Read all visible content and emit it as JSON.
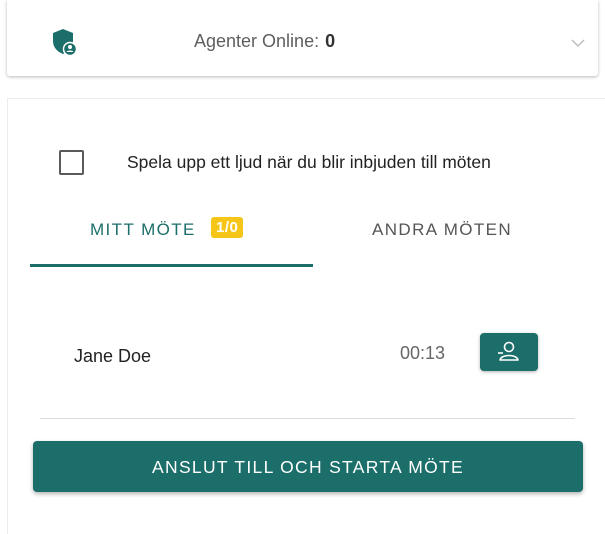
{
  "header": {
    "agents_label": "Agenter Online:",
    "agents_count": "0",
    "icons": {
      "status": "shield-person-icon",
      "expand": "chevron-down-icon"
    }
  },
  "settings": {
    "sound_checkbox_label": "Spela upp ett ljud när du blir inbjuden till möten",
    "sound_checkbox_checked": false
  },
  "tabs": [
    {
      "label": "MITT MÖTE",
      "badge": "1/0",
      "active": true
    },
    {
      "label": "ANDRA MÖTEN",
      "active": false
    }
  ],
  "participants": [
    {
      "name": "Jane Doe",
      "time": "00:13",
      "action_icon": "invite-person-icon"
    }
  ],
  "actions": {
    "start_label": "ANSLUT TILL OCH STARTA MÖTE"
  },
  "colors": {
    "accent": "#1c6e6a",
    "badge": "#f5c518"
  }
}
